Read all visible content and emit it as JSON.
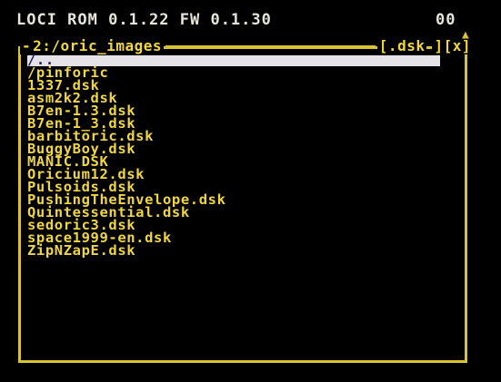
{
  "header": {
    "title": "LOCI ROM 0.1.22 FW 0.1.30",
    "clock": "00"
  },
  "window": {
    "path": "2:/oric_images",
    "filter": "[.dsk",
    "close": "][x]",
    "left_cap": "-"
  },
  "files": [
    {
      "name": "/..",
      "selected": true
    },
    {
      "name": "/pinforic",
      "selected": false
    },
    {
      "name": "1337.dsk",
      "selected": false
    },
    {
      "name": "asm2k2.dsk",
      "selected": false
    },
    {
      "name": "B7en-1.3.dsk",
      "selected": false
    },
    {
      "name": "B7en-1_3.dsk",
      "selected": false
    },
    {
      "name": "barbitoric.dsk",
      "selected": false
    },
    {
      "name": "BuggyBoy.dsk",
      "selected": false
    },
    {
      "name": "MANIC.DSK",
      "selected": false
    },
    {
      "name": "Oricium12.dsk",
      "selected": false
    },
    {
      "name": "Pulsoids.dsk",
      "selected": false
    },
    {
      "name": "PushingTheEnvelope.dsk",
      "selected": false
    },
    {
      "name": "Quintessential.dsk",
      "selected": false
    },
    {
      "name": "sedoric3.dsk",
      "selected": false
    },
    {
      "name": "space1999-en.dsk",
      "selected": false
    },
    {
      "name": "ZipNZapE.dsk",
      "selected": false
    }
  ],
  "colors": {
    "foreground": "#f0d640",
    "frame": "#d9c233",
    "selection_bg": "#e6e3e8",
    "selection_fg": "#1d1d6a",
    "background": "#000000"
  }
}
